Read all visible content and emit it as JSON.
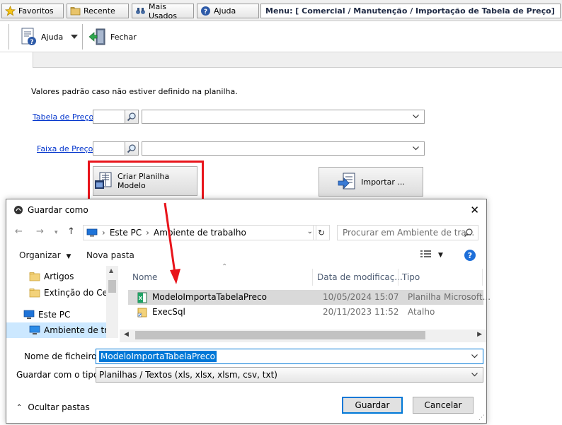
{
  "tabs": [
    {
      "label": "Favoritos",
      "icon": "star-icon"
    },
    {
      "label": "Recente",
      "icon": "folder-icon"
    },
    {
      "label": "Mais Usados",
      "icon": "binoculars-icon"
    },
    {
      "label": "Ajuda",
      "icon": "help-icon"
    }
  ],
  "menu_path": "Menu: [ Comercial / Manutenção / Importação de Tabela de Preço]",
  "toolbar": {
    "help_label": "Ajuda",
    "close_label": "Fechar"
  },
  "form": {
    "note": "Valores padrão caso não estiver definido na planilha.",
    "price_table_label": "Tabela de Preço:",
    "price_range_label": "Faixa de Preço:",
    "create_template_label": "Criar Planilha Modelo",
    "import_label": "Importar ..."
  },
  "annotation_color": "#e8141b",
  "dialog": {
    "title": "Guardar como",
    "breadcrumb": [
      "Este PC",
      "Ambiente de trabalho"
    ],
    "search_placeholder": "Procurar em Ambiente de tra...",
    "organize_label": "Organizar",
    "new_folder_label": "Nova pasta",
    "nav_items": [
      "Artigos",
      "Extinção do Cert",
      "Este PC",
      "Ambiente de trab"
    ],
    "columns": [
      "Nome",
      "Data de modificaç...",
      "Tipo"
    ],
    "files": [
      {
        "name": "ModeloImportaTabelaPreco",
        "date": "10/05/2024 15:07",
        "type": "Planilha Microsoft..."
      },
      {
        "name": "ExecSql",
        "date": "20/11/2023 11:52",
        "type": "Atalho"
      }
    ],
    "filename_label": "Nome de ficheiro:",
    "filename_value": "ModeloImportaTabelaPreco",
    "filetype_label": "Guardar com o tipo:",
    "filetype_value": "Planilhas / Textos (xls, xlsx, xlsm, csv, txt)",
    "hide_folders_label": "Ocultar pastas",
    "save_label": "Guardar",
    "cancel_label": "Cancelar"
  }
}
